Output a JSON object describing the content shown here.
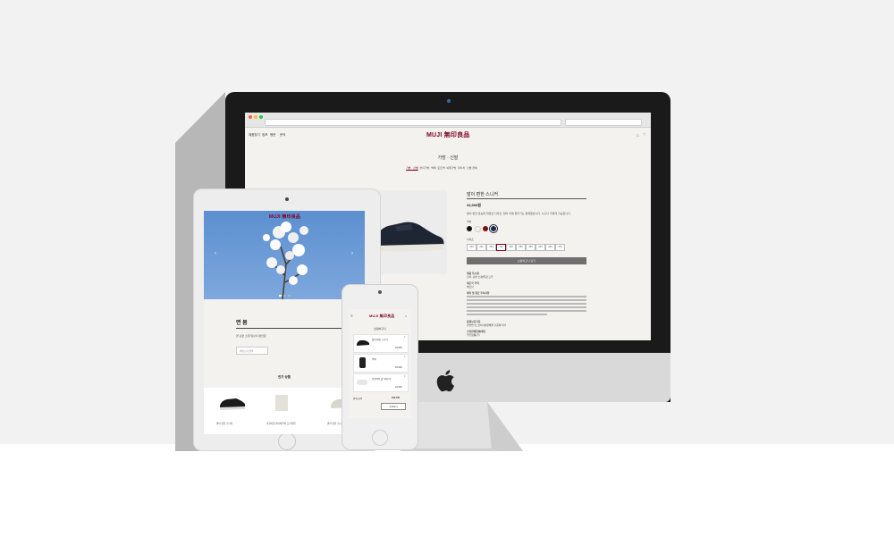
{
  "desktop": {
    "nav": [
      "제품찾기",
      "점포",
      "행운",
      "문의"
    ],
    "logo_text": "MUJI 無印良品",
    "page_title": "가방 · 신발",
    "subnav": [
      "가방 · 신발",
      "숄더가방",
      "백팩",
      "토트백",
      "여행가방",
      "파우치",
      "신발 전체",
      "여행 가방"
    ],
    "product": {
      "name": "발이 편한 스니커",
      "price": "34,900원",
      "description": "발이 편한 만능화 재질로 디자인, 접어 리에 편리기는 편해했습니다. 누구나 가볍게 가능합니다.",
      "color_label": "색상",
      "size_label": "사이즈",
      "sizes": [
        "220",
        "230",
        "235",
        "240",
        "245",
        "250",
        "255",
        "260",
        "265",
        "270"
      ],
      "selected_size": "240",
      "add_to_cart": "쇼핑바구니 담기",
      "details": [
        {
          "title": "제품 주소재",
          "value": "갑피: 순면 소재/밑창:고무"
        },
        {
          "title": "제조국 국적",
          "value": "베트남"
        },
        {
          "title": "세탁 및 취급 주의사항"
        },
        {
          "title": "품질보증기준",
          "value": "관련법 및 소비자분쟁해결 기준에 의거"
        },
        {
          "title": "수입판매업체/제조",
          "value": "무인양품(주)"
        }
      ]
    },
    "colors": {
      "swatches": [
        "#111111",
        "#f4f2ee",
        "#7a1218",
        "#1d2a45"
      ],
      "brand": "#7d0022",
      "button": "#6f6f6f"
    }
  },
  "tablet": {
    "logo_text": "MUJI 無印良品",
    "section_title": "면 봄",
    "section_sub": "면 순면 소재 일상의 편안함",
    "select_placeholder": "카테고리 선택",
    "popular_title": "인기 상품",
    "cards": [
      "발이 편한 스니커",
      "목걸이형 숄더파우치 프리미엄",
      "발이 편한 스니커"
    ]
  },
  "phone": {
    "logo_text": "MUJI 無印良品",
    "title": "쇼핑바구니",
    "items": [
      {
        "name": "발이 편한 스니커",
        "price": "34,900"
      },
      {
        "name": "백팩",
        "price": "49,900"
      },
      {
        "name": "목걸이형 숄더파우치",
        "price": "24,900"
      }
    ],
    "total_label": "합계 금액",
    "total_value": "109,700",
    "order_button": "주문하기"
  }
}
